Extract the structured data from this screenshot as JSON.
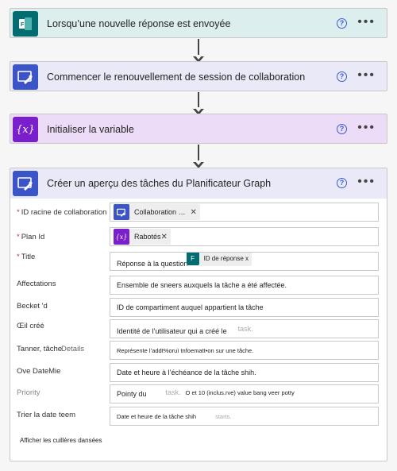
{
  "colors": {
    "forms": "#036c70",
    "forms_bg": "#dcefee",
    "graph": "#3b55c9",
    "graph_bg": "#e9e9f7",
    "variable": "#7b1fcd",
    "variable_bg": "#ecdcf7"
  },
  "steps": [
    {
      "title": "Lorsqu’une nouvelle réponse est envoyée",
      "icon": "forms-icon"
    },
    {
      "title": "Commencer le renouvellement de session de collaboration",
      "icon": "graph-wrench-icon"
    },
    {
      "title": "Initialiser la variable",
      "icon": "variable-braces-icon"
    },
    {
      "title": "Créer un aperçu des tâches du Planificateur Graph",
      "icon": "graph-wrench-icon"
    }
  ],
  "form": {
    "rows": [
      {
        "label": "ID racine de collaboration",
        "required": true,
        "token": "Collaboration …",
        "token_icon": "graph-wrench-icon"
      },
      {
        "label": "Plan Id",
        "required": true,
        "token": "Rabotés",
        "token_icon": "variable-braces-icon"
      },
      {
        "label": "Title",
        "required": true,
        "value": "Réponse à la question",
        "token": "ID de réponse x",
        "token_icon": "forms-icon"
      },
      {
        "label": "Affectations",
        "value": "Ensemble de sneers auxquels la tâche a été affectée."
      },
      {
        "label": "Becket 'd",
        "value": "ID de compartiment auquel appartient la tâche"
      },
      {
        "label": "Œil créé",
        "value": "Identité de l’utilisateur qui a créé le",
        "ghost": "task."
      },
      {
        "label": "Tanner, tâche",
        "label_overlay": "Details",
        "value": "Représente l’addt%oruì tnfoematt•on sur une tâche."
      },
      {
        "label": "Ove DateMie",
        "value": "Date et heure à l’échéance de la tâche shih."
      },
      {
        "label": "Priority",
        "value": "Pointy du",
        "ghost": "task.",
        "extra": "O et 10 (inclus.rve)  value bang veer potty"
      },
      {
        "label": "Trier la date teem",
        "value": "Date et heure de la tâche shih",
        "ghost": "starts."
      }
    ],
    "show_advanced": "Afficher les cuillères dansées"
  },
  "menu": {
    "more": "•••",
    "help": "?"
  }
}
